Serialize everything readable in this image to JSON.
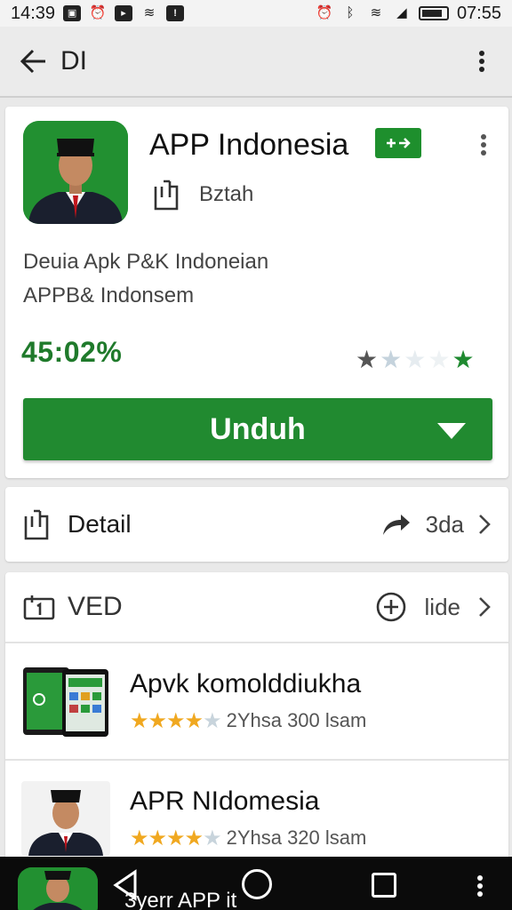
{
  "status_bar": {
    "time": "14:39",
    "right_time": "07:55",
    "left_icons": [
      "photo-icon",
      "alarm-icon",
      "play-icon",
      "wifi-icon",
      "notification-icon"
    ],
    "right_icons": [
      "alarm-icon",
      "bluetooth-icon",
      "wifi-icon",
      "signal-icon",
      "battery-icon"
    ]
  },
  "app_bar": {
    "title": "DI",
    "back_icon": "arrow-left-icon",
    "menu_icon": "more-vertical-icon"
  },
  "app_card": {
    "name": "APP Indonesia",
    "badge_icon": "transfer-icon",
    "developer": "Bztah",
    "description_lines": [
      "Deuia Apk P&K Indoneian",
      "APPB& Indonsem"
    ],
    "rating_percent": "45:02%",
    "stars": {
      "dark": 1,
      "light": 3,
      "green": 1
    },
    "download_label": "Unduh",
    "colors": {
      "accent": "#218a30",
      "rating_text": "#1f7a2b"
    }
  },
  "detail_row": {
    "label": "Detail",
    "value": "3da",
    "icon": "document-icon",
    "share_icon": "share-icon"
  },
  "list_section": {
    "title": "VED",
    "link": "lide",
    "header_icon": "calendar-icon",
    "add_icon": "add-circle-icon",
    "items": [
      {
        "name": "Apvk komolddiukha",
        "rating": 4,
        "info": "2Yhsa 300  lsam"
      },
      {
        "name": "APR NIdomesia",
        "rating": 4,
        "info": "2Yhsa 320  lsam"
      }
    ]
  },
  "nav_bar": {
    "label": "3yerr APP it"
  }
}
